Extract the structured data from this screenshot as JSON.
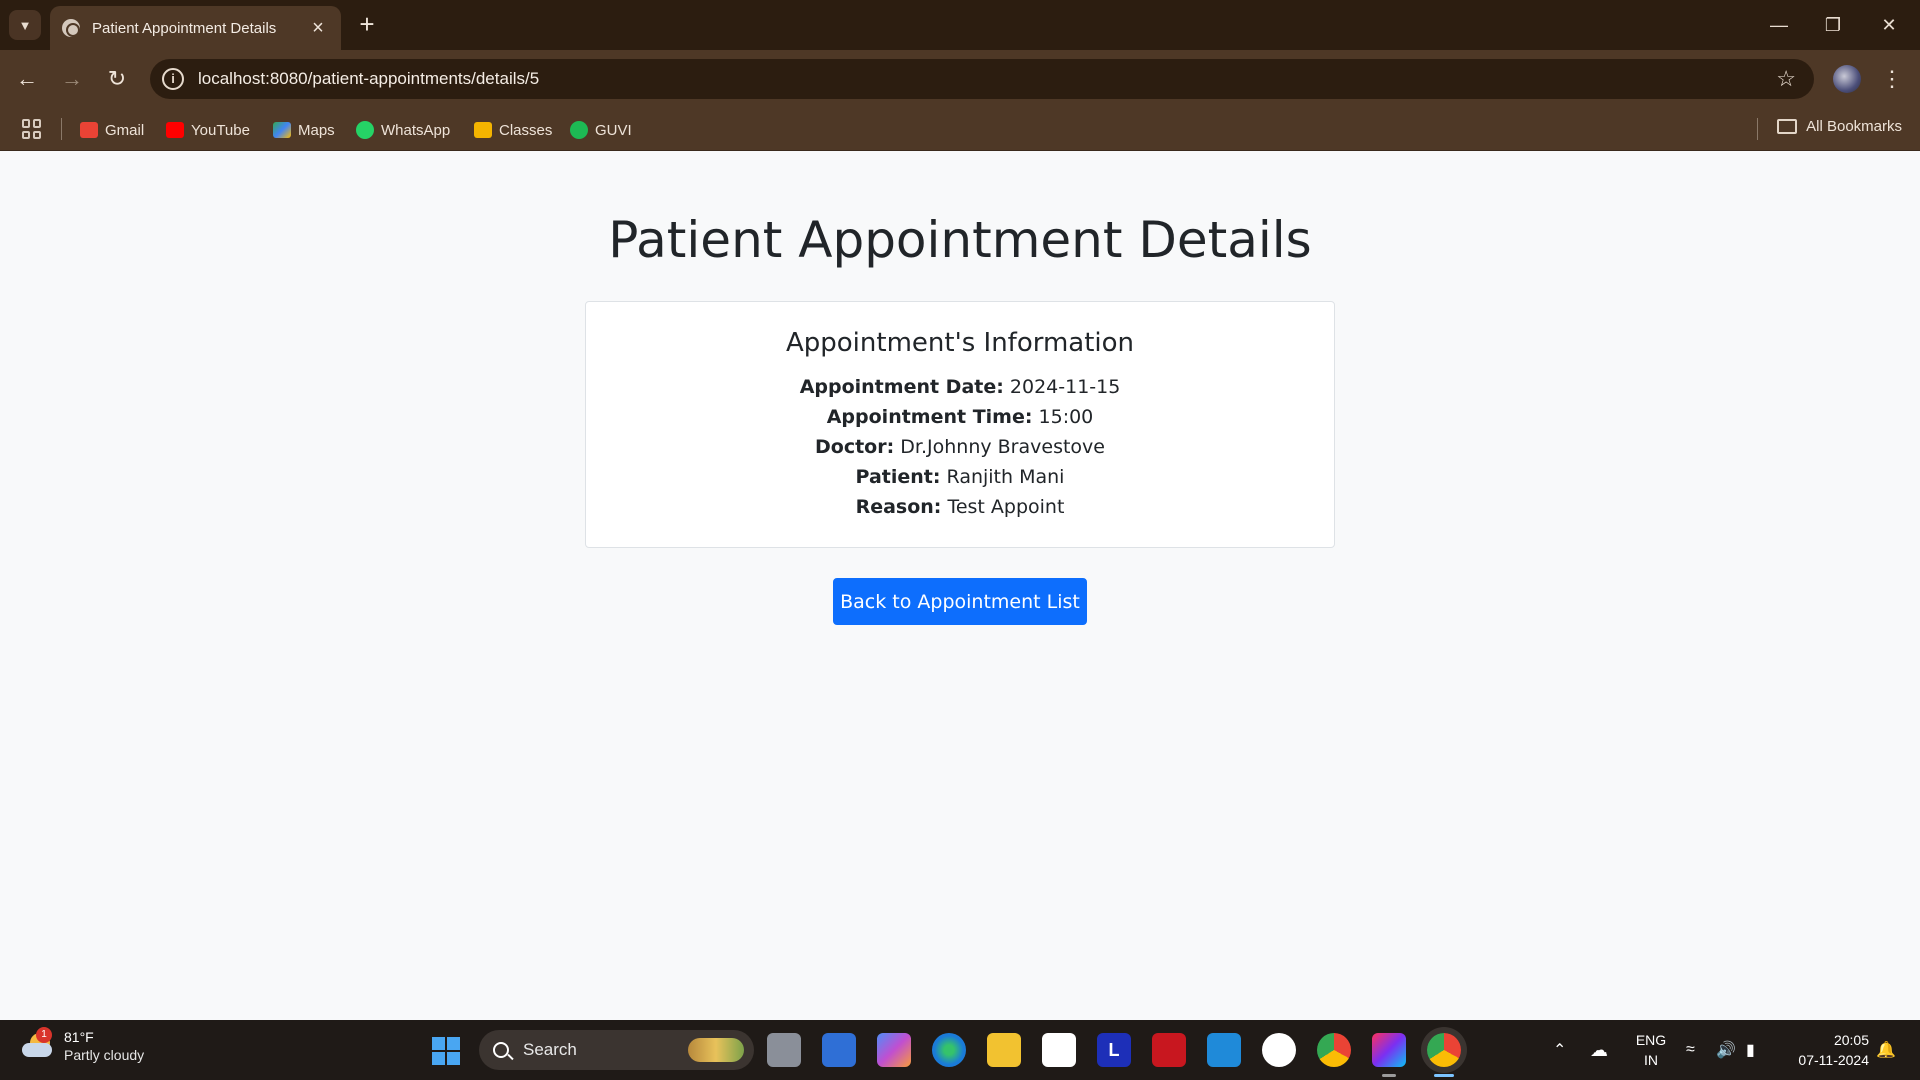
{
  "browser": {
    "tab_title": "Patient Appointment Details",
    "url": "localhost:8080/patient-appointments/details/5",
    "bookmarks": [
      {
        "label": "Gmail",
        "color": "#ea4335"
      },
      {
        "label": "YouTube",
        "color": "#ff0000"
      },
      {
        "label": "Maps",
        "color": "#34a853"
      },
      {
        "label": "WhatsApp",
        "color": "#25d366"
      },
      {
        "label": "Classes",
        "color": "#f4b400"
      },
      {
        "label": "GUVI",
        "color": "#1db954"
      }
    ],
    "all_bookmarks": "All Bookmarks"
  },
  "page": {
    "title": "Patient Appointment Details",
    "card_title": "Appointment's Information",
    "fields": [
      {
        "label": "Appointment Date:",
        "value": "2024-11-15"
      },
      {
        "label": "Appointment Time:",
        "value": "15:00"
      },
      {
        "label": "Doctor:",
        "value": "Dr.Johnny Bravestove"
      },
      {
        "label": "Patient:",
        "value": "Ranjith Mani"
      },
      {
        "label": "Reason:",
        "value": "Test Appoint"
      }
    ],
    "back_button": "Back to Appointment List",
    "accent_color": "#0d6efd"
  },
  "taskbar": {
    "weather_temp": "81°F",
    "weather_condition": "Partly cloudy",
    "weather_badge": "1",
    "search_label": "Search",
    "lang_line1": "ENG",
    "lang_line2": "IN",
    "time": "20:05",
    "date": "07-11-2024"
  }
}
